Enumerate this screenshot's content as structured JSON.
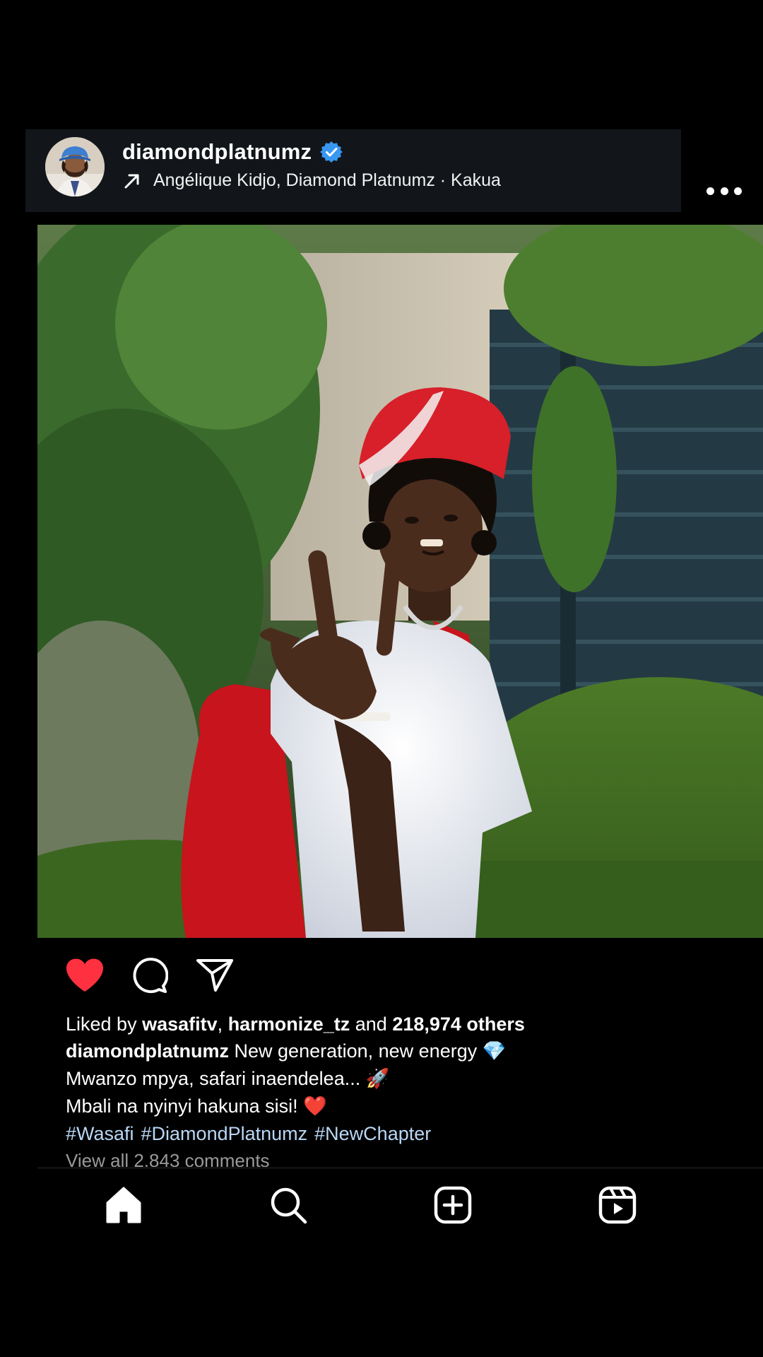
{
  "post": {
    "username": "diamondplatnumz",
    "verified": true,
    "music": {
      "arrow_icon": "arrow-up-right-icon",
      "text": "Angélique Kidjo, Diamond Platnumz · Kakua"
    },
    "more_icon": "ellipsis-icon"
  },
  "actions": {
    "like_icon": "heart-filled-icon",
    "comment_icon": "comment-icon",
    "share_icon": "send-icon",
    "liked_color": "#ff3040"
  },
  "likes": {
    "prefix": "Liked by",
    "user1": "wasafitv",
    "separator": ",",
    "user2": "harmonize_tz",
    "and_text": "and",
    "others": "218,974 others"
  },
  "caption": {
    "author": "diamondplatnumz",
    "line1": "New generation, new energy",
    "line1_emoji": "💎",
    "line2": "Mwanzo mpya, safari inaendelea...",
    "line2_emoji": "🚀",
    "line3": "Mbali na nyinyi hakuna sisi!",
    "line3_emoji": "❤️",
    "hashtags": [
      "#Wasafi",
      "#DiamondPlatnumz",
      "#NewChapter"
    ],
    "view_comments": "View all 2,843 comments"
  },
  "bottom_nav": {
    "items": [
      "home-icon",
      "search-icon",
      "create-post-icon",
      "reels-icon"
    ]
  },
  "colors": {
    "header_bg": "#12161b",
    "hashtag": "#b9d7f5",
    "verified": "#3897f0",
    "background": "#000000"
  }
}
